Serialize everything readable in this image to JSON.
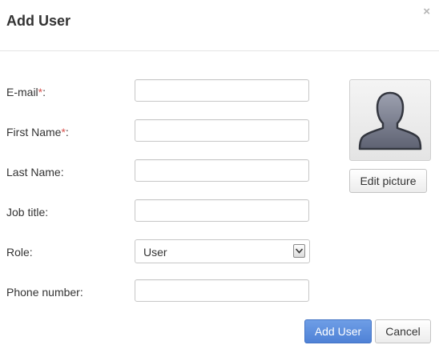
{
  "dialog": {
    "title": "Add User",
    "close_glyph": "×"
  },
  "form": {
    "email": {
      "label": "E-mail",
      "required_mark": "*",
      "suffix": ":",
      "value": ""
    },
    "first_name": {
      "label": "First Name",
      "required_mark": "*",
      "suffix": ":",
      "value": ""
    },
    "last_name": {
      "label": "Last Name:",
      "value": ""
    },
    "job_title": {
      "label": "Job title:",
      "value": ""
    },
    "role": {
      "label": "Role:",
      "selected": "User"
    },
    "phone": {
      "label": "Phone number:",
      "value": ""
    }
  },
  "avatar": {
    "icon": "user-silhouette-icon",
    "edit_label": "Edit picture"
  },
  "footer": {
    "add_label": "Add User",
    "cancel_label": "Cancel"
  },
  "colors": {
    "accent": "#5b8cdc",
    "required": "#d9534f"
  }
}
